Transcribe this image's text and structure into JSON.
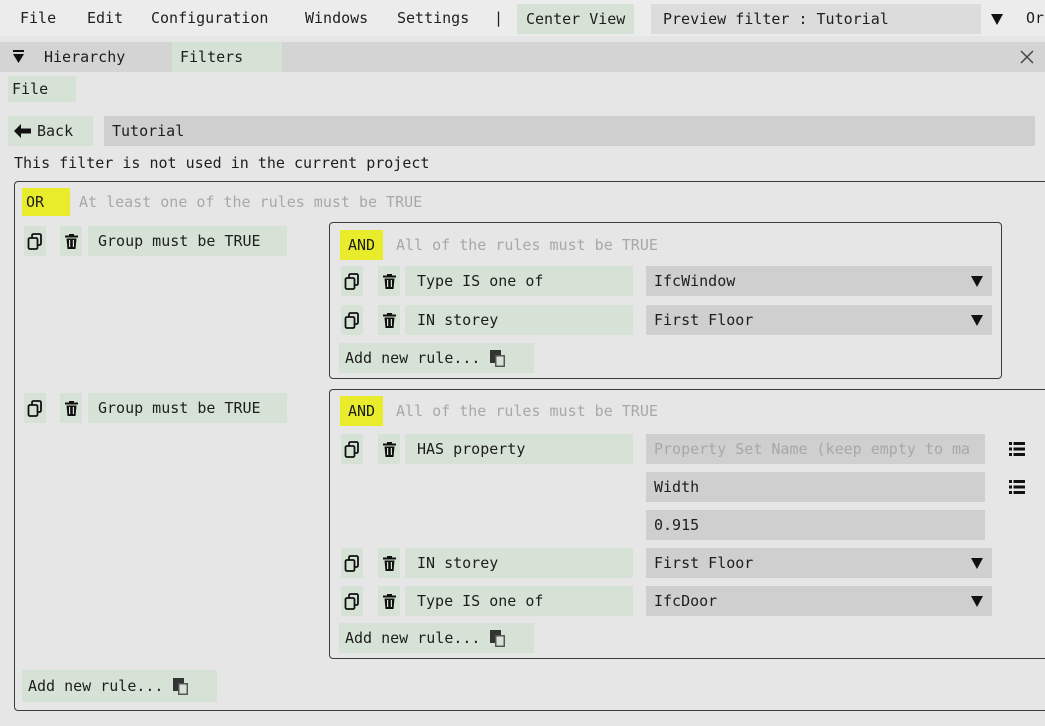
{
  "menu": {
    "file": "File",
    "edit": "Edit",
    "configuration": "Configuration",
    "windows": "Windows",
    "settings": "Settings",
    "separator": "|",
    "center_view": "Center View",
    "preview_filter": "Preview filter : Tutorial",
    "overflow": "Or"
  },
  "tabs": {
    "hierarchy": "Hierarchy",
    "filters": "Filters"
  },
  "toolbar": {
    "file": "File"
  },
  "filter": {
    "back_label": "Back",
    "name": "Tutorial",
    "notice": "This filter is not used in the current project"
  },
  "root": {
    "operator": "OR",
    "description": "At least one of the rules must be TRUE",
    "add_rule": "Add new rule..."
  },
  "groups": [
    {
      "label": "Group must be TRUE",
      "operator": "AND",
      "description": "All of the rules must be TRUE",
      "rules": [
        {
          "label": "Type IS one of",
          "value": "IfcWindow"
        },
        {
          "label": "IN storey",
          "value": "First Floor"
        }
      ],
      "add_rule": "Add new rule..."
    },
    {
      "label": "Group must be TRUE",
      "operator": "AND",
      "description": "All of the rules must be TRUE",
      "property_rule": {
        "label": "HAS property",
        "pset_placeholder": "Property Set Name (keep empty to ma",
        "property_name": "Width",
        "property_value": "0.915"
      },
      "rules": [
        {
          "label": "IN storey",
          "value": "First Floor"
        },
        {
          "label": "Type IS one of",
          "value": "IfcDoor"
        }
      ],
      "add_rule": "Add new rule..."
    }
  ],
  "colors": {
    "button_bg": "#d6e2d6",
    "field_bg": "#cfcfcf",
    "highlight": "#e8ec2a",
    "background": "#e6e6e6"
  },
  "icons": [
    "copy-icon",
    "trash-icon",
    "dropdown-arrow-icon",
    "list-icon",
    "paste-icon",
    "back-arrow-icon",
    "collapse-triangle-icon",
    "close-icon"
  ]
}
